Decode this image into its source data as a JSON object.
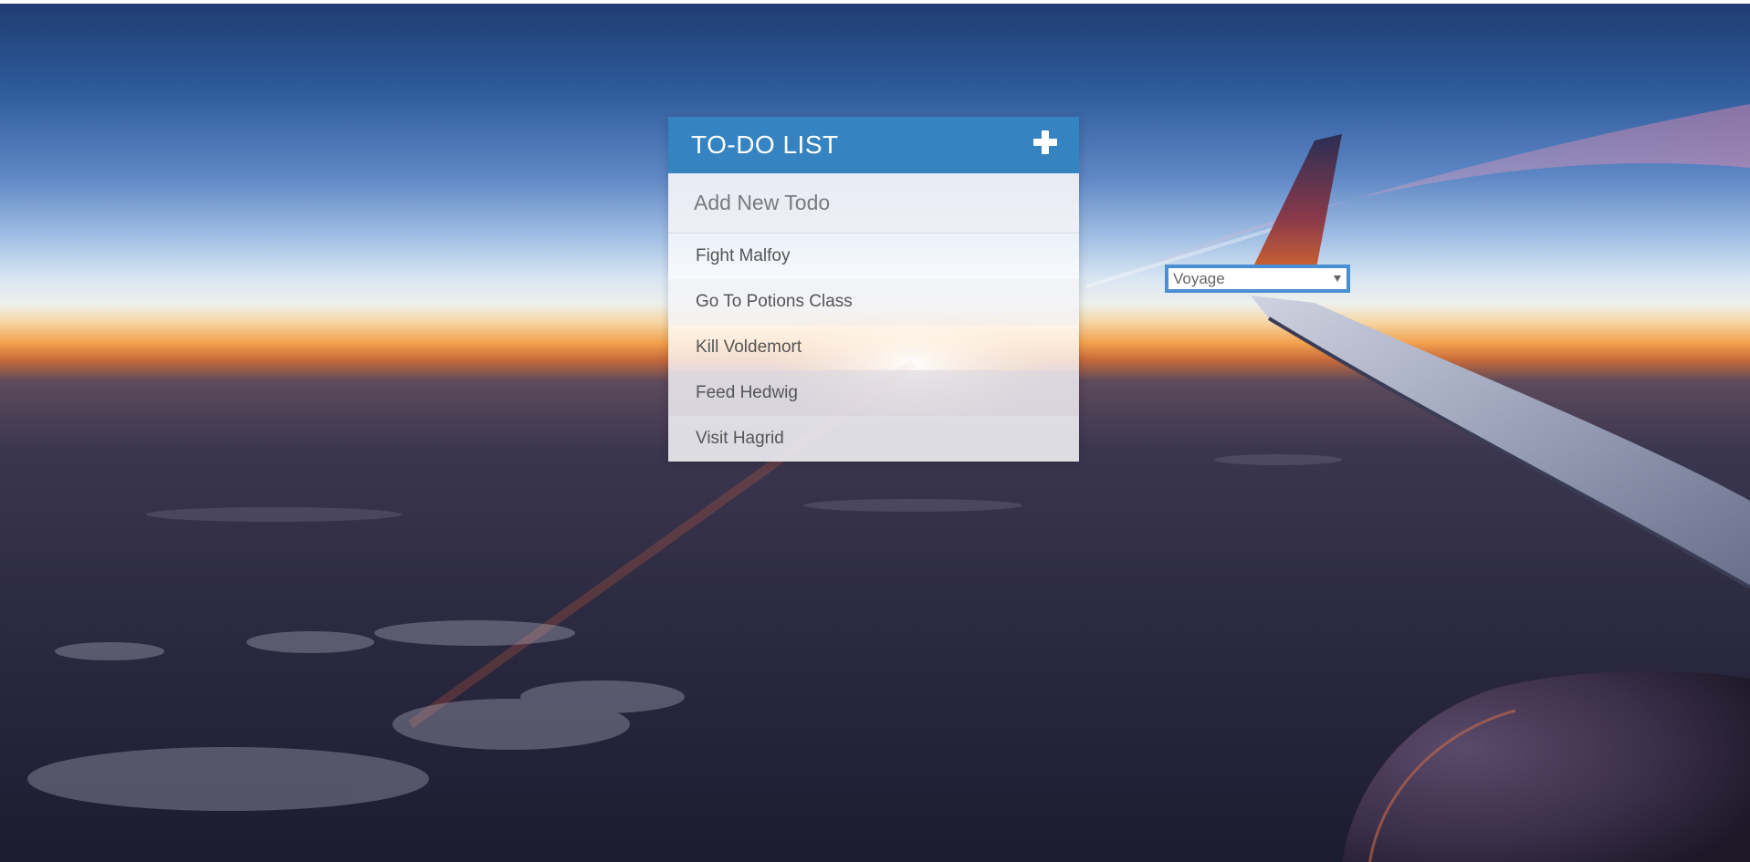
{
  "header": {
    "title": "TO-DO LIST",
    "add_icon": "plus-icon"
  },
  "new_todo": {
    "placeholder": "Add New Todo",
    "value": ""
  },
  "todos": [
    {
      "label": "Fight Malfoy"
    },
    {
      "label": "Go To Potions Class"
    },
    {
      "label": "Kill Voldemort"
    },
    {
      "label": "Feed Hedwig"
    },
    {
      "label": "Visit Hagrid"
    }
  ],
  "theme_select": {
    "selected": "Voyage",
    "icon": "chevron-down-icon"
  },
  "colors": {
    "header_bg": "#3583c0",
    "select_border": "#4a8fd6"
  }
}
